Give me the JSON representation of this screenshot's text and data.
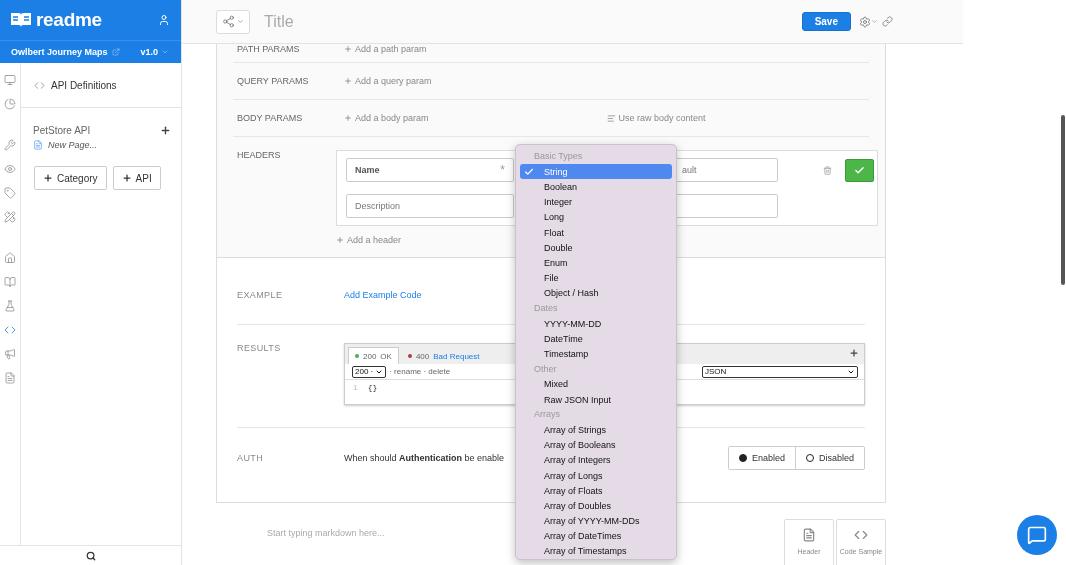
{
  "brand": {
    "name": "readme"
  },
  "project": {
    "name": "Owlbert Journey Maps",
    "version": "v1.0"
  },
  "rail": [
    {
      "items": [
        {
          "kind": "monitor",
          "selected": false
        },
        {
          "kind": "chart",
          "selected": false
        }
      ]
    },
    {
      "items": [
        {
          "kind": "wrench",
          "selected": false
        },
        {
          "kind": "eye",
          "selected": false
        },
        {
          "kind": "tag",
          "selected": false
        },
        {
          "kind": "ruler",
          "selected": false
        }
      ]
    },
    {
      "items": [
        {
          "kind": "home",
          "selected": false
        },
        {
          "kind": "book",
          "selected": false
        },
        {
          "kind": "flask",
          "selected": false
        },
        {
          "kind": "code",
          "selected": true
        },
        {
          "kind": "megaphone",
          "selected": false
        },
        {
          "kind": "file",
          "selected": false
        }
      ]
    }
  ],
  "nav": {
    "section": "API Definitions",
    "api_name": "PetStore API",
    "new_page": "New Page...",
    "buttons": [
      {
        "label": "Category"
      },
      {
        "label": "API"
      }
    ]
  },
  "topbar": {
    "title_placeholder": "Title",
    "save": "Save"
  },
  "params": [
    {
      "label": "PATH PARAMS",
      "action": "Add a path param"
    },
    {
      "label": "QUERY PARAMS",
      "action": "Add a query param"
    },
    {
      "label": "BODY PARAMS",
      "action": "Add a body param",
      "extra": "Use raw body content"
    }
  ],
  "headers": {
    "label": "HEADERS",
    "name_placeholder": "Name",
    "required_mark": "*",
    "default_placeholder": "ault",
    "description_placeholder": "Description",
    "add": "Add a header"
  },
  "example": {
    "label": "EXAMPLE",
    "link": "Add Example Code"
  },
  "results": {
    "label": "RESULTS",
    "tabs": [
      {
        "code": "200",
        "text": "OK",
        "selected": true,
        "color": "#4caf50"
      },
      {
        "code": "400",
        "text": "Bad Request",
        "selected": false,
        "color": "#b03a48"
      }
    ],
    "status_value": "200 ·",
    "actions": "· rename · delete",
    "format": "JSON",
    "line_number": "1",
    "code": "{}"
  },
  "auth": {
    "label": "AUTH",
    "question": "When should **Authentication** be enable",
    "options": [
      {
        "label": "Enabled",
        "selected": true
      },
      {
        "label": "Disabled",
        "selected": false
      }
    ]
  },
  "editor": {
    "placeholder": "Start typing markdown here...",
    "tools": [
      {
        "kind": "header",
        "label": "Header"
      },
      {
        "kind": "code",
        "label": "Code Sample"
      }
    ]
  },
  "type_menu": {
    "groups": [
      {
        "title": "Basic Types",
        "items": [
          {
            "label": "String",
            "selected": true
          },
          {
            "label": "Boolean",
            "selected": false
          },
          {
            "label": "Integer",
            "selected": false
          },
          {
            "label": "Long",
            "selected": false
          },
          {
            "label": "Float",
            "selected": false
          },
          {
            "label": "Double",
            "selected": false
          },
          {
            "label": "Enum",
            "selected": false
          },
          {
            "label": "File",
            "selected": false
          },
          {
            "label": "Object / Hash",
            "selected": false
          }
        ]
      },
      {
        "title": "Dates",
        "items": [
          {
            "label": "YYYY-MM-DD",
            "selected": false
          },
          {
            "label": "DateTime",
            "selected": false
          },
          {
            "label": "Timestamp",
            "selected": false
          }
        ]
      },
      {
        "title": "Other",
        "items": [
          {
            "label": "Mixed",
            "selected": false
          },
          {
            "label": "Raw JSON Input",
            "selected": false
          }
        ]
      },
      {
        "title": "Arrays",
        "items": [
          {
            "label": "Array of Strings",
            "selected": false
          },
          {
            "label": "Array of Booleans",
            "selected": false
          },
          {
            "label": "Array of Integers",
            "selected": false
          },
          {
            "label": "Array of Longs",
            "selected": false
          },
          {
            "label": "Array of Floats",
            "selected": false
          },
          {
            "label": "Array of Doubles",
            "selected": false
          },
          {
            "label": "Array of YYYY-MM-DDs",
            "selected": false
          },
          {
            "label": "Array of DateTimes",
            "selected": false
          },
          {
            "label": "Array of Timestamps",
            "selected": false
          }
        ]
      }
    ]
  }
}
